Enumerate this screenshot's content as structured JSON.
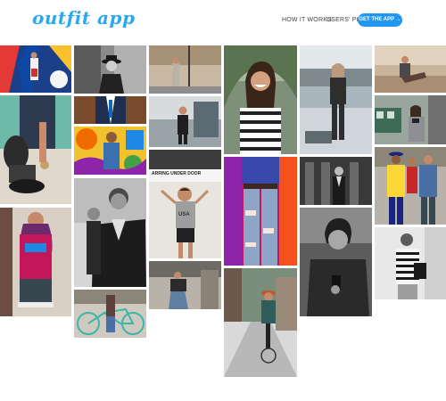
{
  "header": {
    "logo": "outfit app",
    "nav": [
      {
        "label": "HOW IT WORKS"
      },
      {
        "label": "USERS' PICS"
      }
    ],
    "cta": "GET THE APP →"
  },
  "gallery": {
    "tiles": [
      {
        "id": "t1",
        "scene": "geometric-wall-woman"
      },
      {
        "id": "t2",
        "scene": "man-shoe-lace"
      },
      {
        "id": "t3",
        "scene": "woman-colorful-dress"
      },
      {
        "id": "t4",
        "scene": "man-fedora-bw"
      },
      {
        "id": "t5",
        "scene": "man-suit-street"
      },
      {
        "id": "t6",
        "scene": "graffiti-wall-man"
      },
      {
        "id": "t7",
        "scene": "man-bw-portrait"
      },
      {
        "id": "t8",
        "scene": "man-bicycle"
      },
      {
        "id": "t9",
        "scene": "woman-lamppost"
      },
      {
        "id": "t10",
        "scene": "woman-walking-street"
      },
      {
        "id": "t11",
        "scene": "woman-usa-shirt",
        "sign": "ARRING UNDER DOOR",
        "shirt": "USA"
      },
      {
        "id": "t12",
        "scene": "woman-street-sitting"
      },
      {
        "id": "t13",
        "scene": "woman-smiling-striped"
      },
      {
        "id": "t14",
        "scene": "ripped-jeans-woman"
      },
      {
        "id": "t15",
        "scene": "woman-cycling-street"
      },
      {
        "id": "t16",
        "scene": "woman-rooftop"
      },
      {
        "id": "t17",
        "scene": "man-bw-corridor"
      },
      {
        "id": "t18",
        "scene": "man-bw-phone"
      },
      {
        "id": "t19",
        "scene": "man-sitting-wall"
      },
      {
        "id": "t20",
        "scene": "woman-train-camera"
      },
      {
        "id": "t21",
        "scene": "group-colorful-suits"
      },
      {
        "id": "t22",
        "scene": "man-striped-shirt-bw"
      }
    ]
  }
}
